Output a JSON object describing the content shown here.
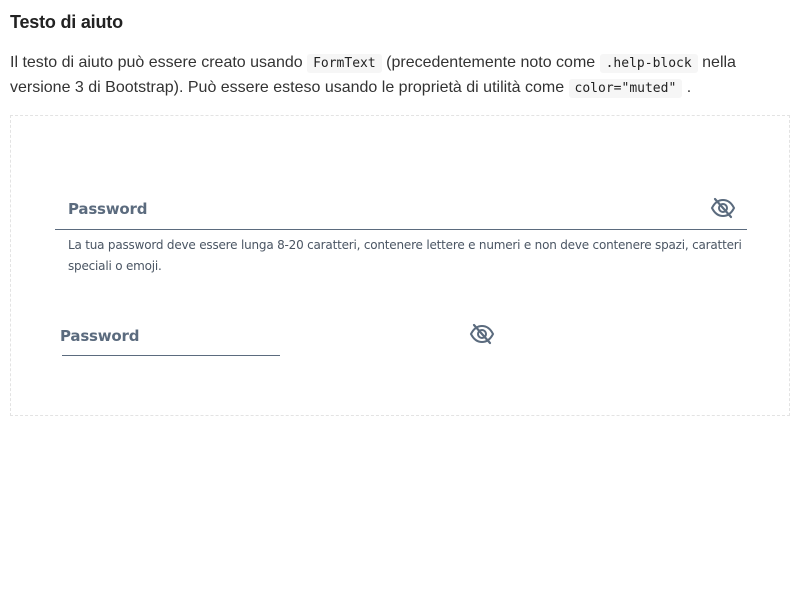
{
  "section": {
    "title": "Testo di aiuto",
    "desc_part1": "Il testo di aiuto può essere creato usando ",
    "code1": "FormText",
    "desc_part2": " (precedentemente noto come ",
    "code2": ".help-block",
    "desc_part3": " nella versione 3 di Bootstrap). Può essere esteso usando le proprietà di utilità come ",
    "code3": "color=\"muted\"",
    "desc_part4": " ."
  },
  "form1": {
    "label": "Password",
    "help_text": "La tua password deve essere lunga 8-20 caratteri, contenere lettere e numeri e non deve contenere spazi, caratteri speciali o emoji.",
    "toggle_icon": "eye-slash-icon"
  },
  "form2": {
    "label": "Password",
    "toggle_icon": "eye-slash-icon"
  },
  "colors": {
    "label": "#5b6b7e",
    "line": "#5b6b7e",
    "help": "#4a5563"
  }
}
